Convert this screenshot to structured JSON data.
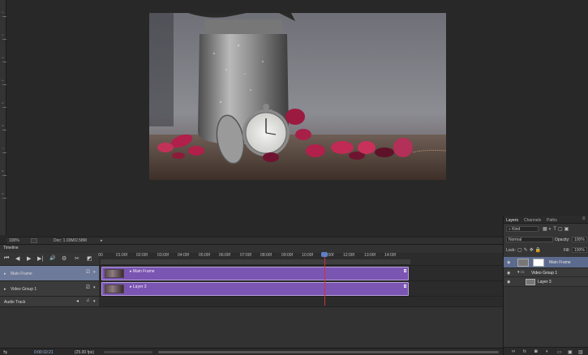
{
  "ruler": {
    "numbers": [
      "1",
      "2",
      "3",
      "4",
      "5",
      "6",
      "7",
      "8",
      "9"
    ]
  },
  "status": {
    "zoom": "100%",
    "doc": "Doc: 1.03M/2.58M",
    "arrow": "▸"
  },
  "timeline": {
    "title": "Timeline",
    "controls": [
      "⏮",
      "◀",
      "▶",
      "▶|",
      "🔊",
      "⚙",
      "✂",
      "◩"
    ],
    "ruler_labels": [
      "00",
      "01:00f",
      "02:00f",
      "03:00f",
      "04:00f",
      "05:00f",
      "06:00f",
      "07:00f",
      "08:00f",
      "09:00f",
      "10:00f",
      "00f",
      "12:00f",
      "13:00f",
      "14:00f"
    ],
    "tracks": [
      {
        "label": "Main Frame",
        "selected": true,
        "clip_name": "Main Frame",
        "icon": "film-icon"
      },
      {
        "label": "Video Group 1",
        "selected": false,
        "clip_name": "Layer 3",
        "icon": "film-icon"
      },
      {
        "label": "Audio Track",
        "selected": false,
        "clip_name": "",
        "icon": "music-icon"
      }
    ],
    "footer": {
      "time": "0:00:10:21",
      "fps": "(25.00 fps)"
    },
    "clip_color": "#7b55b2",
    "playhead_color": "#d23232"
  },
  "layers_panel": {
    "tabs": [
      "Layers",
      "Channels",
      "Paths"
    ],
    "active_tab": "Layers",
    "filter_kind": "Kind",
    "blend_mode": "Normal",
    "opacity_label": "Opacity:",
    "opacity_value": "100%",
    "lock_label": "Lock:",
    "fill_label": "Fill:",
    "fill_value": "100%",
    "layers": [
      {
        "name": "Main Frame",
        "selected": true
      },
      {
        "name": "Video Group 1",
        "selected": false
      },
      {
        "name": "Layer 3",
        "selected": false
      }
    ],
    "footer_icons": [
      "link-icon",
      "fx-icon",
      "mask-icon",
      "adjustment-icon",
      "folder-icon",
      "new-layer-icon",
      "trash-icon"
    ]
  }
}
